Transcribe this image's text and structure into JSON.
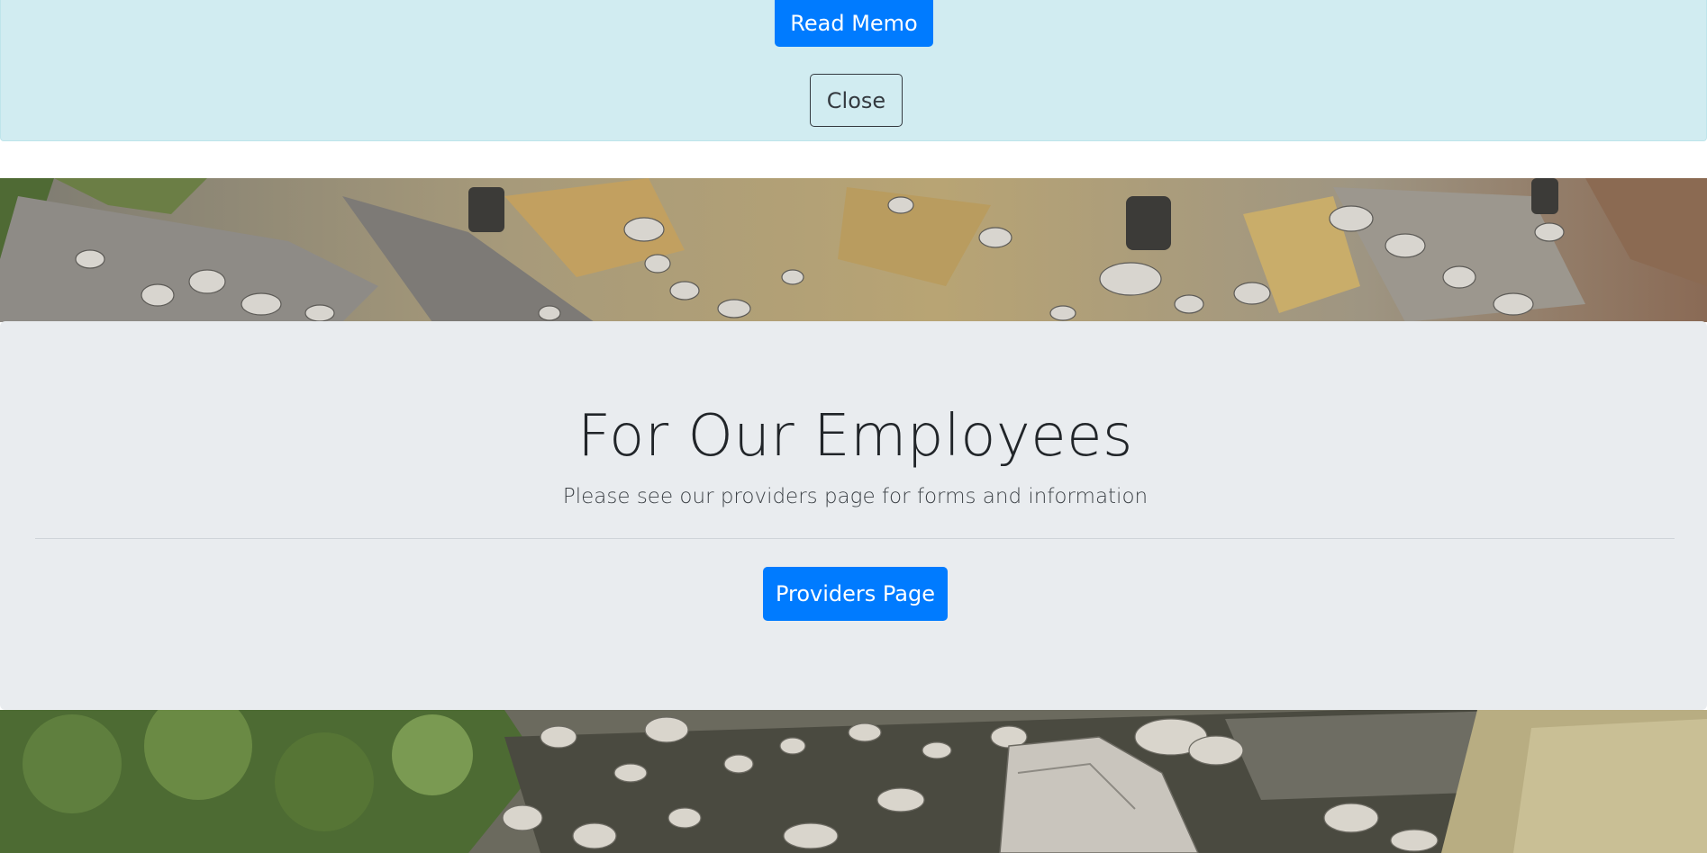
{
  "memo_alert": {
    "read_memo_label": "Read Memo",
    "close_label": "Close",
    "background": "#d1ecf1"
  },
  "employees_section": {
    "title": "For Our Employees",
    "lead": "Please see our providers page for forms and information",
    "providers_button_label": "Providers Page",
    "background": "#e9ecef"
  },
  "colors": {
    "primary": "#007bff",
    "text": "#212529"
  },
  "images": {
    "top_banner": "rocky-hillside-photo",
    "bottom_banner": "river-rocks-photo"
  }
}
